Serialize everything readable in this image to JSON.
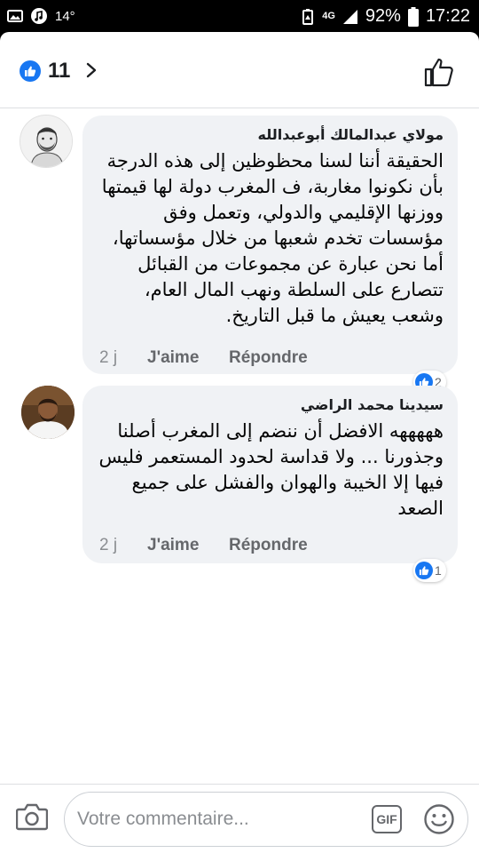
{
  "status_bar": {
    "temperature": "14°",
    "network": "4G",
    "battery": "92%",
    "time": "17:22"
  },
  "header": {
    "like_count": "11"
  },
  "comments": [
    {
      "author": "مولاي عبدالمالك أبوعبدالله",
      "text": "الحقيقة أننا لسنا محظوظين إلى هذه الدرجة بأن نكونوا مغاربة، ف المغرب دولة لها قيمتها ووزنها الإقليمي والدولي، وتعمل وفق مؤسسات تخدم شعبها من خلال مؤسساتها، أما نحن عبارة عن مجموعات من القبائل تتصارع على السلطة ونهب المال العام، وشعب يعيش ما قبل التاريخ.",
      "time": "2 j",
      "like_label": "J'aime",
      "reply_label": "Répondre",
      "reactions": "2"
    },
    {
      "author": "سيدينا محمد الراضي",
      "text": "هههههه الافضل أن ننضم إلى المغرب أصلنا وجذورنا ... ولا قداسة لحدود المستعمر فليس فيها إلا الخيبة والهوان والفشل على جميع الصعد",
      "time": "2 j",
      "like_label": "J'aime",
      "reply_label": "Répondre",
      "reactions": "1"
    }
  ],
  "composer": {
    "placeholder": "Votre commentaire...",
    "gif_label": "GIF"
  },
  "colors": {
    "accent": "#1877f2",
    "bubble": "#f0f2f5",
    "muted": "#65676b"
  }
}
